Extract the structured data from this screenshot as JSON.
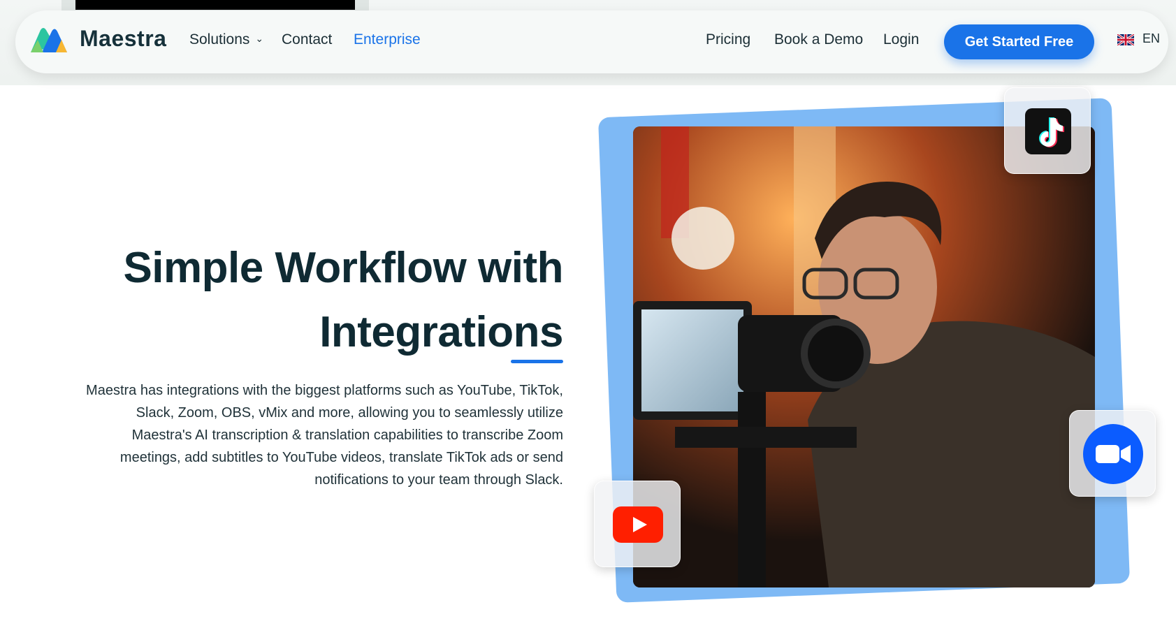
{
  "brand": {
    "name": "Maestra"
  },
  "nav": {
    "solutions": "Solutions",
    "contact": "Contact",
    "enterprise": "Enterprise",
    "pricing": "Pricing",
    "book_demo": "Book a Demo",
    "login": "Login",
    "cta": "Get Started Free",
    "language": "EN"
  },
  "hero": {
    "title_line1": "Simple Workflow with",
    "title_line2": "Integrations",
    "description": "Maestra has integrations with the biggest platforms such as YouTube, TikTok, Slack, Zoom, OBS, vMix and more, allowing you to seamlessly utilize Maestra's AI transcription & translation capabilities to transcribe Zoom meetings, add subtitles to YouTube videos, translate TikTok ads or send notifications to your team through Slack."
  },
  "integrations": {
    "icons": [
      "tiktok-icon",
      "youtube-icon",
      "zoom-icon"
    ]
  },
  "colors": {
    "accent": "#1a73e8",
    "card_blue": "#7eb9f5",
    "heading": "#0f2a33",
    "youtube_red": "#ff0000",
    "zoom_blue": "#0b5cff"
  }
}
